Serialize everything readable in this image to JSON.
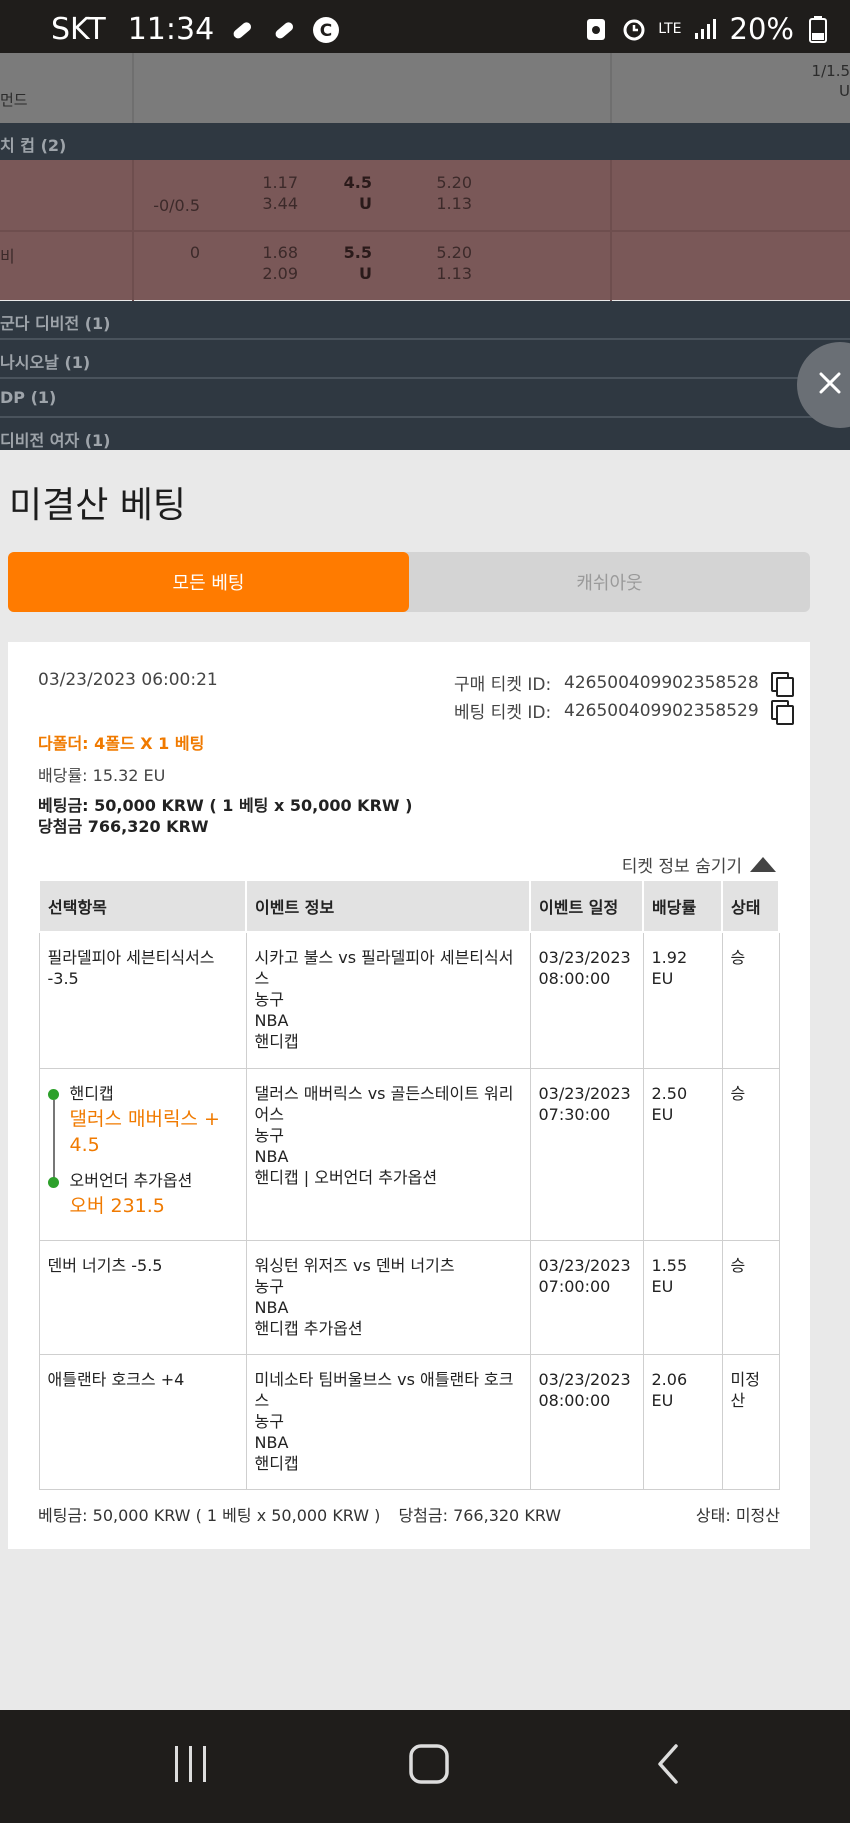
{
  "status_bar": {
    "carrier": "SKT",
    "time": "11:34",
    "network": "LTE",
    "battery": "20%"
  },
  "background": {
    "header_left": "먼드",
    "header_right": "1/1.5",
    "header_right2": "U",
    "leagues": [
      "치 컵 (2)",
      "군다 디비전 (1)",
      "나시오날 (1)",
      "DP (1)",
      "디비전 여자 (1)"
    ],
    "rows": [
      {
        "name": "",
        "handicap": "-0/0.5",
        "h1": "1.17",
        "h2": "3.44",
        "line": "4.5",
        "ou": "U",
        "o1": "5.20",
        "o2": "1.13"
      },
      {
        "name": "비",
        "handicap": "0",
        "h1": "1.68",
        "h2": "2.09",
        "line": "5.5",
        "ou": "U",
        "o1": "5.20",
        "o2": "1.13"
      }
    ]
  },
  "sheet": {
    "title": "미결산 베팅",
    "tabs": [
      {
        "label": "모든 베팅",
        "active": true
      },
      {
        "label": "캐쉬아웃",
        "active": false
      }
    ],
    "ticket": {
      "date": "03/23/2023 06:00:21",
      "purchase_id_label": "구매 티켓 ID:",
      "purchase_id": "426500409902358528",
      "bet_id_label": "베팅 티켓 ID:",
      "bet_id": "426500409902358529",
      "bet_type": "다폴더: 4폴드 X 1 베팅",
      "odds": "배당률: 15.32 EU",
      "stake": "베팅금: 50,000 KRW ( 1 베팅 x 50,000 KRW )",
      "winnings": "당첨금 766,320 KRW",
      "hide_info": "티켓 정보 숨기기",
      "columns": [
        "선택항목",
        "이벤트 정보",
        "이벤트 일정",
        "배당률",
        "상태"
      ],
      "selections": [
        {
          "pick": "필라델피아 세븐티식서스 -3.5",
          "event": "시카고 불스 vs 필라델피아 세븐티식서스",
          "sport": "농구",
          "league": "NBA",
          "market": "핸디캡",
          "date": "03/23/2023",
          "time": "08:00:00",
          "odds": "1.92 EU",
          "status": "승"
        },
        {
          "multi": true,
          "label1": "핸디캡",
          "pick1": "댈러스 매버릭스 + 4.5",
          "label2": "오버언더 추가옵션",
          "pick2": "오버 231.5",
          "event": "댈러스 매버릭스 vs 골든스테이트 워리어스",
          "sport": "농구",
          "league": "NBA",
          "market": "핸디캡 | 오버언더 추가옵션",
          "date": "03/23/2023",
          "time": "07:30:00",
          "odds": "2.50 EU",
          "status": "승"
        },
        {
          "pick": "덴버 너기츠 -5.5",
          "event": "워싱턴 위저즈 vs 덴버 너기츠",
          "sport": "농구",
          "league": "NBA",
          "market": "핸디캡 추가옵션",
          "date": "03/23/2023",
          "time": "07:00:00",
          "odds": "1.55 EU",
          "status": "승"
        },
        {
          "pick": "애틀랜타 호크스 +4",
          "event": "미네소타 팀버울브스 vs 애틀랜타 호크스",
          "sport": "농구",
          "league": "NBA",
          "market": "핸디캡",
          "date": "03/23/2023",
          "time": "08:00:00",
          "odds": "2.06 EU",
          "status": "미정산"
        }
      ],
      "footer_stake": "베팅금: 50,000 KRW ( 1 베팅 x 50,000 KRW )",
      "footer_win": "당첨금: 766,320 KRW",
      "footer_status": "상태: 미정산"
    }
  },
  "icons": {
    "close": "close-icon",
    "copy": "copy-icon",
    "collapse": "triangle-up-icon",
    "nav_recent": "recent-apps-icon",
    "nav_home": "home-icon",
    "nav_back": "back-icon"
  },
  "colors": {
    "accent": "#ff7b00",
    "pick_orange": "#f07a00",
    "status_green": "#2da02b"
  }
}
